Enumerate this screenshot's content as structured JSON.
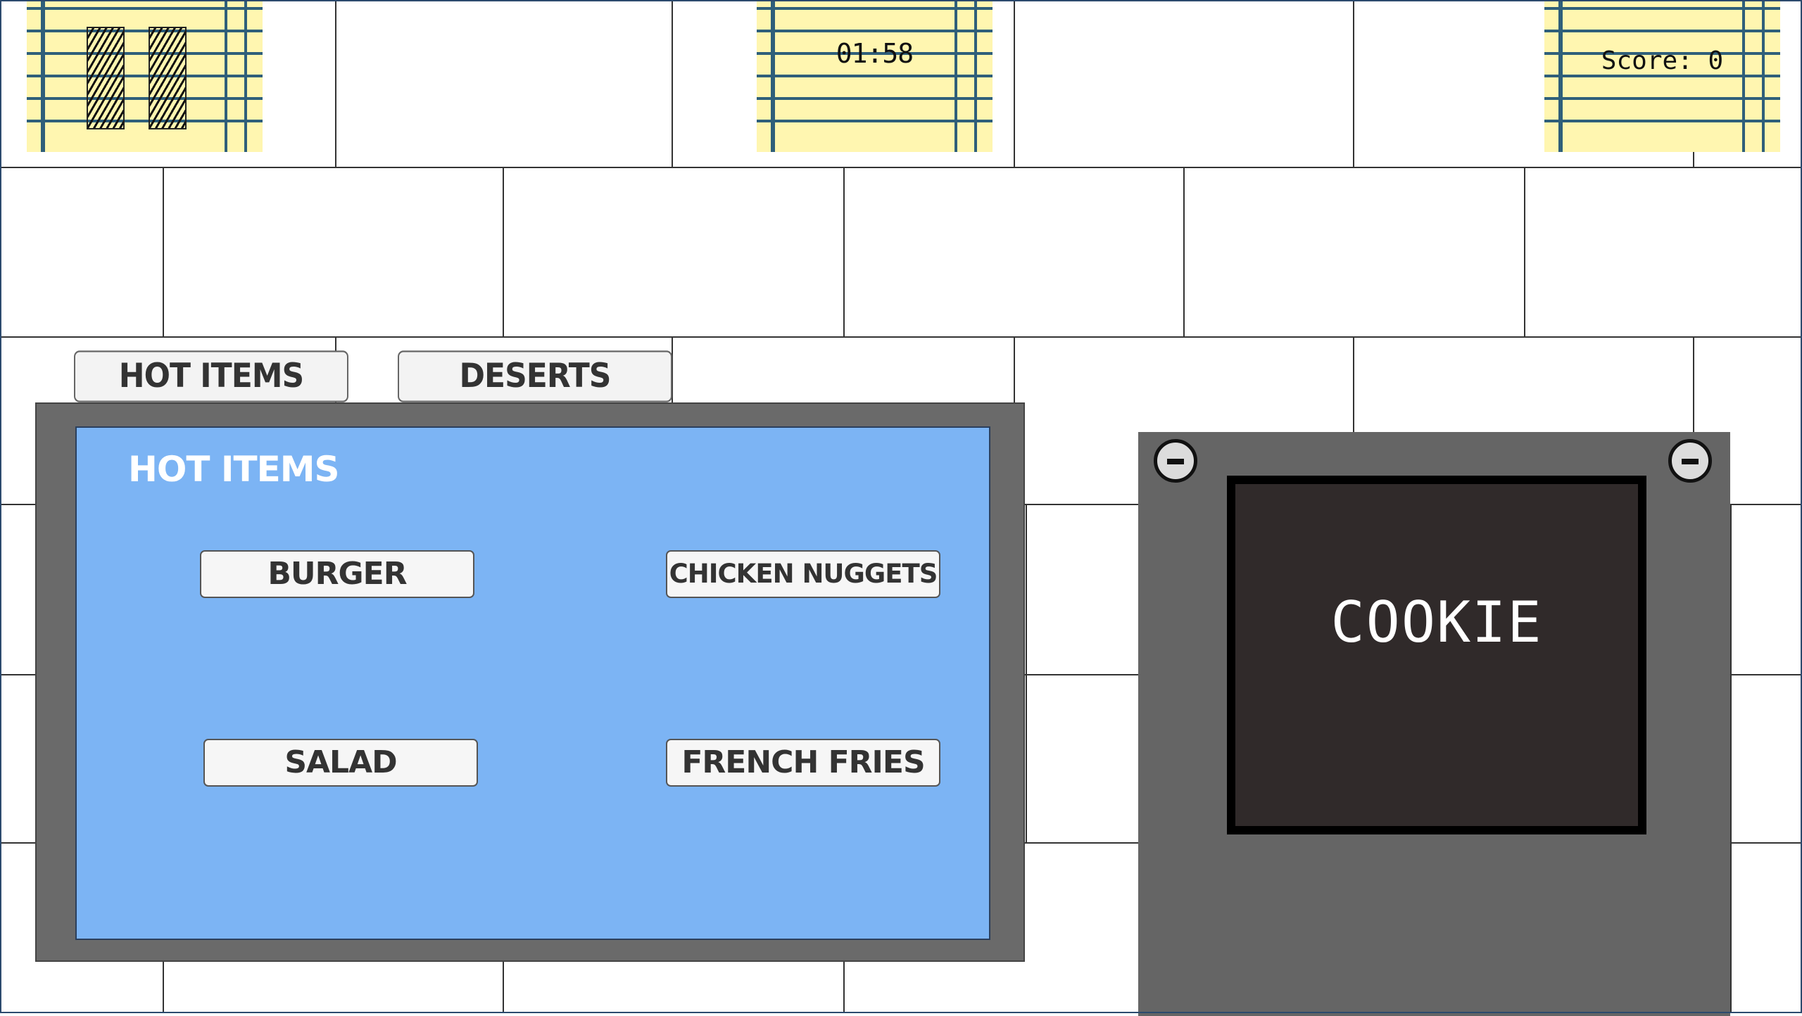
{
  "hud": {
    "pause_button": {
      "label": "Pause",
      "icon": "pause-icon"
    },
    "timer": "01:58",
    "score": "Score: 0"
  },
  "tabs": [
    {
      "label": "HOT ITEMS",
      "active": true
    },
    {
      "label": "DESERTS",
      "active": false
    }
  ],
  "menu_panel": {
    "title": "HOT ITEMS",
    "items": [
      {
        "label": "BURGER"
      },
      {
        "label": "CHICKEN NUGGETS"
      },
      {
        "label": "SALAD"
      },
      {
        "label": "FRENCH FRIES"
      }
    ]
  },
  "order_display": {
    "text": "COOKIE"
  },
  "colors": {
    "note_paper": "#fff6b0",
    "note_lines": "#2f5f7a",
    "panel_frame": "#6a6a6a",
    "panel_bg": "#7cb4f4",
    "device_body": "#656565",
    "device_screen": "#302a2a"
  }
}
